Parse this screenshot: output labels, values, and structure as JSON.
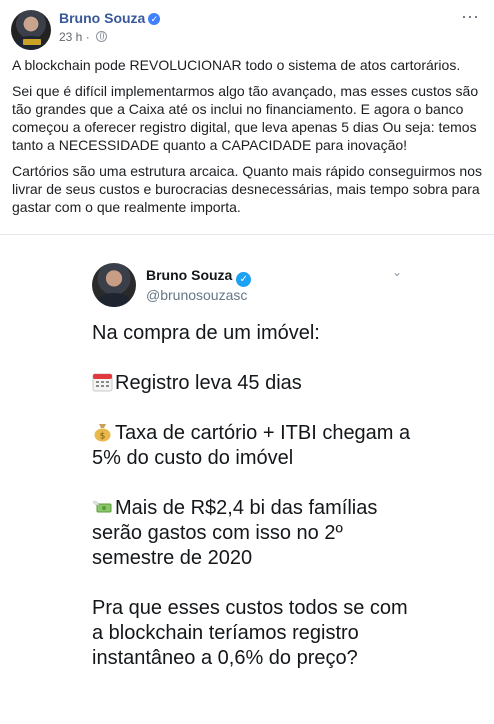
{
  "post": {
    "author": "Bruno Souza",
    "time": "23 h ·",
    "paragraphs": [
      "A blockchain pode REVOLUCIONAR todo o sistema de atos cartorários.",
      "Sei que é difícil implementarmos algo tão avançado, mas esses custos são tão grandes que a Caixa até os inclui no financiamento. E agora o banco começou a oferecer registro digital, que leva apenas 5 dias Ou seja: temos tanto a NECESSIDADE quanto a CAPACIDADE para inovação!",
      "Cartórios são uma estrutura arcaica. Quanto mais rápido conseguirmos nos livrar de seus custos e burocracias desnecessárias, mais tempo sobra para gastar com o que realmente importa."
    ]
  },
  "tweet": {
    "name": "Bruno Souza",
    "handle": "@brunosouzasc",
    "intro": "Na compra de um imóvel:",
    "item1": "Registro leva 45 dias",
    "item2": "Taxa de cartório + ITBI chegam a 5% do custo do imóvel",
    "item3": "Mais de R$2,4 bi das famílias serão gastos com isso no 2º semestre de 2020",
    "closing": "Pra que esses custos todos se com a blockchain teríamos registro instantâneo a 0,6% do preço?"
  },
  "icons": {
    "verified": "verified-badge-icon",
    "globe": "globe-icon",
    "more": "more-options-icon",
    "chevron": "chevron-down-icon",
    "calendar": "calendar-emoji-icon",
    "moneybag": "money-bag-emoji-icon",
    "flying_money": "money-with-wings-emoji-icon"
  },
  "colors": {
    "fb_name": "#385898",
    "fb_verified": "#4080ff",
    "tw_verified": "#1da1f2"
  }
}
